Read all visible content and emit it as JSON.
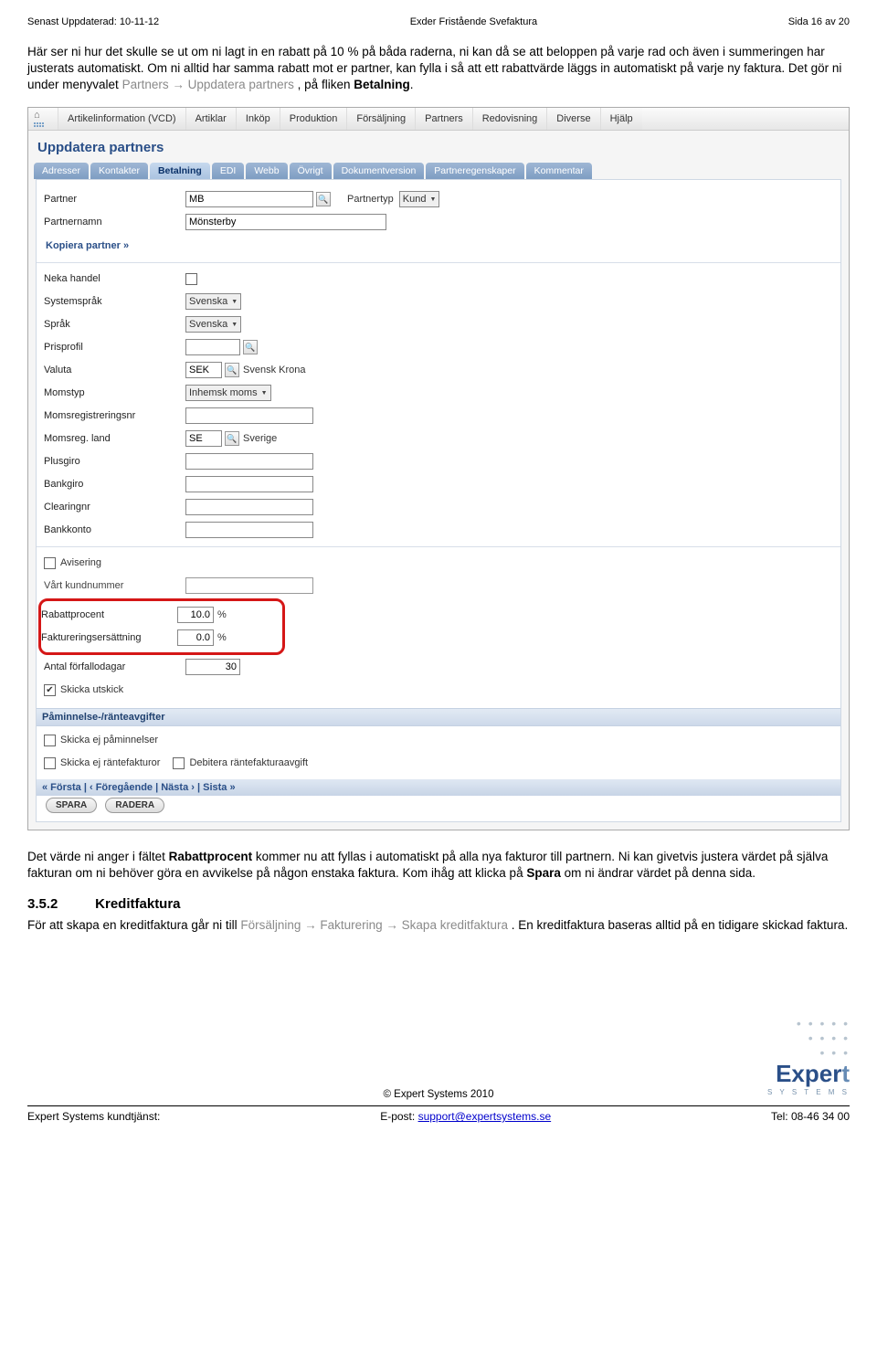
{
  "page_header": {
    "left": "Senast Uppdaterad: 10-11-12",
    "center": "Exder Fristående Svefaktura",
    "right": "Sida 16 av 20"
  },
  "intro_paragraph": {
    "p1": "Här ser ni hur det skulle se ut om ni lagt in en rabatt på 10 % på båda raderna, ni kan då se att beloppen på varje rad och även i summeringen har justerats automatiskt. Om ni alltid har samma rabatt mot er partner, kan fylla i så att ett rabattvärde läggs in automatiskt på varje ny faktura. Det gör ni under menyvalet ",
    "grey1": "Partners → Uppdatera partners",
    "p2": ", på fliken ",
    "bold1": "Betalning",
    "p3": "."
  },
  "app": {
    "menubar": {
      "items": [
        "Artikelinformation (VCD)",
        "Artiklar",
        "Inköp",
        "Produktion",
        "Försäljning",
        "Partners",
        "Redovisning",
        "Diverse",
        "Hjälp"
      ]
    },
    "title": "Uppdatera partners",
    "tabs": [
      "Adresser",
      "Kontakter",
      "Betalning",
      "EDI",
      "Webb",
      "Övrigt",
      "Dokumentversion",
      "Partneregenskaper",
      "Kommentar"
    ],
    "active_tab_index": 2,
    "partner_row": {
      "partner_label": "Partner",
      "partner_value": "MB",
      "partnertyp_label": "Partnertyp",
      "partnertyp_value": "Kund"
    },
    "partnernamn_row": {
      "label": "Partnernamn",
      "value": "Mönsterby"
    },
    "kopiera_link": "Kopiera partner »",
    "fields": [
      {
        "label": "Neka handel",
        "type": "checkbox",
        "checked": false
      },
      {
        "label": "Systemspråk",
        "type": "select",
        "value": "Svenska"
      },
      {
        "label": "Språk",
        "type": "select",
        "value": "Svenska"
      },
      {
        "label": "Prisprofil",
        "type": "lookup",
        "value": ""
      },
      {
        "label": "Valuta",
        "type": "lookup",
        "value": "SEK",
        "display": "Svensk Krona"
      },
      {
        "label": "Momstyp",
        "type": "select",
        "value": "Inhemsk moms"
      },
      {
        "label": "Momsregistreringsnr",
        "type": "text",
        "value": ""
      },
      {
        "label": "Momsreg. land",
        "type": "lookup",
        "value": "SE",
        "display": "Sverige"
      },
      {
        "label": "Plusgiro",
        "type": "text",
        "value": ""
      },
      {
        "label": "Bankgiro",
        "type": "text",
        "value": ""
      },
      {
        "label": "Clearingnr",
        "type": "text",
        "value": ""
      },
      {
        "label": "Bankkonto",
        "type": "text",
        "value": ""
      }
    ],
    "avisering_row": {
      "label": "Avisering",
      "checked": false
    },
    "vart_kundnr_row": {
      "label": "Vårt kundnummer",
      "value": ""
    },
    "rabatt_row": {
      "label": "Rabattprocent",
      "value": "10.0",
      "unit": "%"
    },
    "faktrepl_row": {
      "label": "Faktureringsersättning",
      "value": "0.0",
      "unit": "%"
    },
    "forfallo_row": {
      "label": "Antal förfallodagar",
      "value": "30"
    },
    "skicka_utskick_row": {
      "label": "Skicka utskick",
      "checked": true
    },
    "reminder_section": {
      "title": "Påminnelse-/ränteavgifter",
      "row1": {
        "label": "Skicka ej påminnelser",
        "checked": false
      },
      "row2": {
        "label": "Skicka ej räntefakturor",
        "checked": false
      },
      "row2b": {
        "label": "Debitera räntefakturaavgift",
        "checked": false
      }
    },
    "pager": "« Första  |  ‹ Föregående  |  Nästa ›  |  Sista »",
    "buttons": {
      "save": "SPARA",
      "delete": "RADERA"
    }
  },
  "after_screenshot": {
    "p1a": "Det värde ni anger i fältet ",
    "b1": "Rabattprocent",
    "p1b": " kommer nu att fyllas i automatiskt på alla nya fakturor till partnern. Ni kan givetvis justera värdet på själva fakturan om ni behöver göra en avvikelse på någon enstaka faktura. Kom ihåg att klicka på ",
    "b2": "Spara",
    "p1c": " om ni ändrar värdet på denna sida."
  },
  "section_352": {
    "num": "3.5.2",
    "title": "Kreditfaktura",
    "p1a": "För att skapa en kreditfaktura går ni till ",
    "grey": "Försäljning → Fakturering → Skapa kreditfaktura",
    "p1b": ". En kreditfaktura baseras alltid på en tidigare skickad faktura."
  },
  "footer": {
    "brand_plain": "Exper",
    "brand_x": "t",
    "systems": "S Y S T E M S",
    "copyright": "© Expert Systems 2010",
    "left": "Expert Systems kundtjänst:",
    "mid_prefix": "E-post: ",
    "mid_link": "support@expertsystems.se",
    "right": "Tel: 08-46 34 00"
  }
}
